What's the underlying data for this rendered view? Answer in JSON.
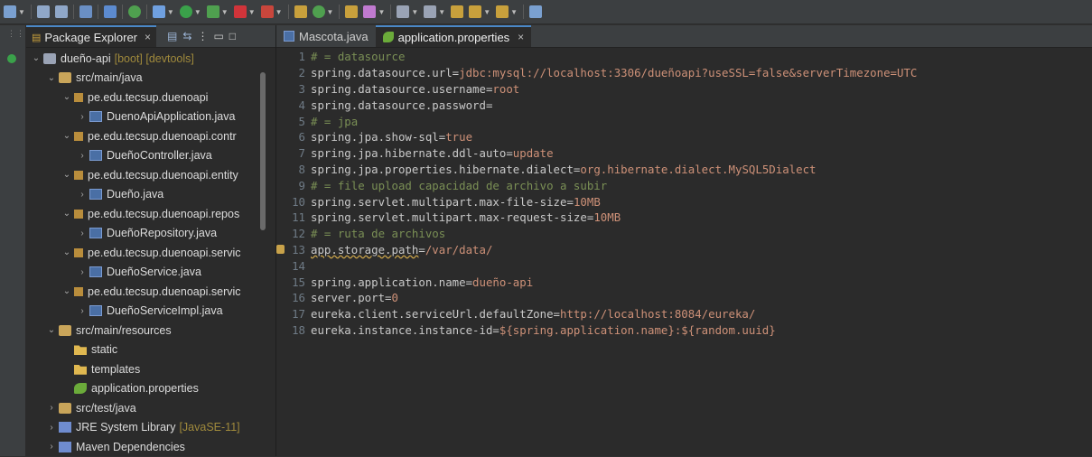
{
  "package_explorer": {
    "tab_label": "Package Explorer",
    "close": "×",
    "tree": [
      {
        "indent": 0,
        "chevron": "v",
        "icon": "project-icon",
        "cls": "ic-proj",
        "label": "dueño-api",
        "deco": "[boot] [devtools]"
      },
      {
        "indent": 1,
        "chevron": "v",
        "icon": "source-folder-icon",
        "cls": "ic-srcf",
        "label": "src/main/java",
        "deco": ""
      },
      {
        "indent": 2,
        "chevron": "v",
        "icon": "package-icon",
        "cls": "ic-pkg",
        "label": "pe.edu.tecsup.duenoapi",
        "deco": ""
      },
      {
        "indent": 3,
        "chevron": ">",
        "icon": "java-class-icon",
        "cls": "ic-java",
        "label": "DuenoApiApplication.java",
        "deco": ""
      },
      {
        "indent": 2,
        "chevron": "v",
        "icon": "package-icon",
        "cls": "ic-pkg",
        "label": "pe.edu.tecsup.duenoapi.contr",
        "deco": ""
      },
      {
        "indent": 3,
        "chevron": ">",
        "icon": "java-class-icon",
        "cls": "ic-java",
        "label": "DueñoController.java",
        "deco": ""
      },
      {
        "indent": 2,
        "chevron": "v",
        "icon": "package-icon",
        "cls": "ic-pkg",
        "label": "pe.edu.tecsup.duenoapi.entity",
        "deco": ""
      },
      {
        "indent": 3,
        "chevron": ">",
        "icon": "java-class-icon",
        "cls": "ic-java",
        "label": "Dueño.java",
        "deco": ""
      },
      {
        "indent": 2,
        "chevron": "v",
        "icon": "package-icon",
        "cls": "ic-pkg",
        "label": "pe.edu.tecsup.duenoapi.repos",
        "deco": ""
      },
      {
        "indent": 3,
        "chevron": ">",
        "icon": "java-interface-icon",
        "cls": "ic-java",
        "label": "DueñoRepository.java",
        "deco": ""
      },
      {
        "indent": 2,
        "chevron": "v",
        "icon": "package-icon",
        "cls": "ic-pkg",
        "label": "pe.edu.tecsup.duenoapi.servic",
        "deco": ""
      },
      {
        "indent": 3,
        "chevron": ">",
        "icon": "java-interface-icon",
        "cls": "ic-java",
        "label": "DueñoService.java",
        "deco": ""
      },
      {
        "indent": 2,
        "chevron": "v",
        "icon": "package-icon",
        "cls": "ic-pkg",
        "label": "pe.edu.tecsup.duenoapi.servic",
        "deco": ""
      },
      {
        "indent": 3,
        "chevron": ">",
        "icon": "java-class-icon",
        "cls": "ic-java",
        "label": "DueñoServiceImpl.java",
        "deco": ""
      },
      {
        "indent": 1,
        "chevron": "v",
        "icon": "source-folder-icon",
        "cls": "ic-srcf",
        "label": "src/main/resources",
        "deco": ""
      },
      {
        "indent": 2,
        "chevron": "",
        "icon": "folder-icon",
        "cls": "ic-folder",
        "label": "static",
        "deco": ""
      },
      {
        "indent": 2,
        "chevron": "",
        "icon": "folder-icon",
        "cls": "ic-folder",
        "label": "templates",
        "deco": ""
      },
      {
        "indent": 2,
        "chevron": "",
        "icon": "properties-file-icon",
        "cls": "ic-props",
        "label": "application.properties",
        "deco": ""
      },
      {
        "indent": 1,
        "chevron": ">",
        "icon": "source-folder-icon",
        "cls": "ic-srcf",
        "label": "src/test/java",
        "deco": ""
      },
      {
        "indent": 1,
        "chevron": ">",
        "icon": "library-icon",
        "cls": "ic-lib",
        "label": "JRE System Library",
        "deco": "[JavaSE-11]"
      },
      {
        "indent": 1,
        "chevron": ">",
        "icon": "library-icon",
        "cls": "ic-lib",
        "label": "Maven Dependencies",
        "deco": ""
      }
    ]
  },
  "editor": {
    "tabs": [
      {
        "label": "Mascota.java",
        "icon": "java-class-icon",
        "active": false
      },
      {
        "label": "application.properties",
        "icon": "properties-file-icon",
        "active": true
      }
    ],
    "close": "×",
    "lines": [
      {
        "n": "1",
        "comment": "# = datasource"
      },
      {
        "n": "2",
        "key": "spring.datasource.url=",
        "val": "jdbc:mysql://localhost:3306/dueñoapi?useSSL=false&serverTimezone=UTC"
      },
      {
        "n": "3",
        "key": "spring.datasource.username=",
        "val": "root"
      },
      {
        "n": "4",
        "key": "spring.datasource.password=",
        "val": ""
      },
      {
        "n": "5",
        "comment": "# = jpa"
      },
      {
        "n": "6",
        "key": "spring.jpa.show-sql=",
        "val": "true"
      },
      {
        "n": "7",
        "key": "spring.jpa.hibernate.ddl-auto=",
        "val": "update"
      },
      {
        "n": "8",
        "key": "spring.jpa.properties.hibernate.dialect=",
        "val": "org.hibernate.dialect.MySQL5Dialect"
      },
      {
        "n": "9",
        "comment": "# = file upload capacidad de archivo a subir"
      },
      {
        "n": "10",
        "key": "spring.servlet.multipart.max-file-size=",
        "val": "10MB"
      },
      {
        "n": "11",
        "key": "spring.servlet.multipart.max-request-size=",
        "val": "10MB"
      },
      {
        "n": "12",
        "comment": "# = ruta de archivos"
      },
      {
        "n": "13",
        "key": "app.storage.path",
        "keyUnderline": true,
        "eq": "=",
        "val": "/var/data/",
        "marker": true
      },
      {
        "n": "14"
      },
      {
        "n": "15",
        "key": "spring.application.name=",
        "val": "dueño-api"
      },
      {
        "n": "16",
        "key": "server.port=",
        "val": "0"
      },
      {
        "n": "17",
        "key": "eureka.client.serviceUrl.defaultZone=",
        "val": "http://localhost:8084/eureka/"
      },
      {
        "n": "18",
        "key": "eureka.instance.instance-id=",
        "val": "${spring.application.name}:${random.uuid}"
      }
    ]
  },
  "colors": {
    "accent": "#4a88c7",
    "comment": "#7a8f55",
    "value": "#ce9178"
  }
}
